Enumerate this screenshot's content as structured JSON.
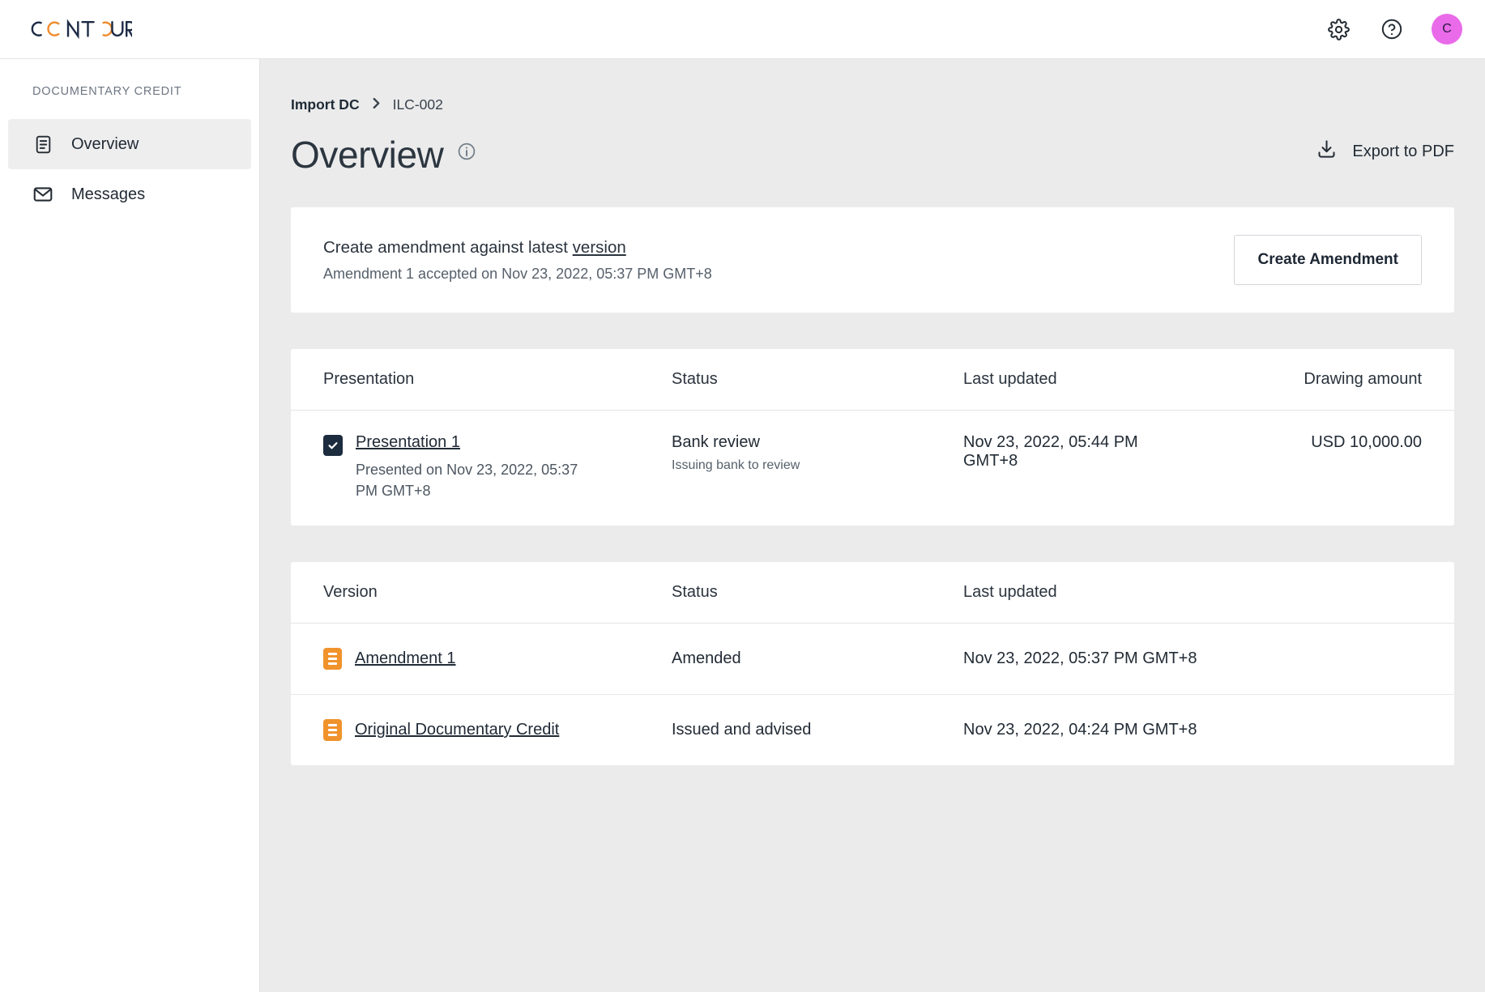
{
  "brand": {
    "logo_letters": [
      "C",
      "O",
      "N",
      "T",
      "O",
      "U",
      "R"
    ],
    "navy": "#1d2b46",
    "orange": "#ef8b2c"
  },
  "topbar": {
    "settings_icon": "gear-icon",
    "help_icon": "question-circle-icon",
    "avatar_initial": "C",
    "avatar_color": "#e96be9"
  },
  "sidebar": {
    "heading": "DOCUMENTARY CREDIT",
    "items": [
      {
        "label": "Overview",
        "icon": "document-icon",
        "active": true
      },
      {
        "label": "Messages",
        "icon": "envelope-icon",
        "active": false
      }
    ]
  },
  "breadcrumb": {
    "root": "Import DC",
    "separator": "›",
    "current": "ILC-002"
  },
  "page": {
    "title": "Overview",
    "info_icon": "info-circle-icon",
    "export_label": "Export to PDF",
    "export_icon": "download-icon"
  },
  "amendment_card": {
    "title_prefix": "Create amendment against latest ",
    "title_link": "version",
    "subtitle": "Amendment 1 accepted on Nov 23, 2022, 05:37 PM GMT+8",
    "button_label": "Create Amendment"
  },
  "presentation_table": {
    "headers": {
      "name": "Presentation",
      "status": "Status",
      "updated": "Last updated",
      "amount": "Drawing amount"
    },
    "rows": [
      {
        "checked": true,
        "name": "Presentation 1",
        "name_sub": "Presented on Nov 23, 2022, 05:37 PM GMT+8",
        "status": "Bank review",
        "status_sub": "Issuing bank to review",
        "updated": "Nov 23, 2022, 05:44 PM GMT+8",
        "amount": "USD 10,000.00"
      }
    ]
  },
  "version_table": {
    "headers": {
      "name": "Version",
      "status": "Status",
      "updated": "Last updated"
    },
    "rows": [
      {
        "icon": "document-badge-icon",
        "name": "Amendment 1",
        "status": "Amended",
        "updated": "Nov 23, 2022, 05:37 PM GMT+8"
      },
      {
        "icon": "document-badge-icon",
        "name": "Original Documentary Credit",
        "status": "Issued and advised",
        "updated": "Nov 23, 2022, 04:24 PM GMT+8"
      }
    ]
  }
}
